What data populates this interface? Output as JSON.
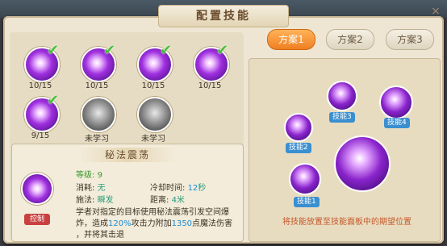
{
  "window": {
    "title": "配置技能",
    "close": "×"
  },
  "skills": [
    {
      "label": "10/15",
      "checked": true
    },
    {
      "label": "10/15",
      "checked": true
    },
    {
      "label": "10/15",
      "checked": true
    },
    {
      "label": "10/15",
      "checked": true
    },
    {
      "label": "9/15",
      "checked": true
    },
    {
      "label": "未学习",
      "checked": false
    },
    {
      "label": "未学习",
      "checked": false
    }
  ],
  "detail": {
    "name": "秘法震荡",
    "level_label": "等级: ",
    "level": "9",
    "cost_label": "消耗: ",
    "cost": "无",
    "cooldown_label": "冷却时间: ",
    "cooldown_value": "12",
    "cooldown_unit": "秒",
    "cast_label": "施法: ",
    "cast": "瞬发",
    "range_label": "距离: ",
    "range": "4米",
    "tag": "控制",
    "desc_1": "学者对指定的目标使用秘法震荡引发空间爆",
    "desc_2a": "炸，造成",
    "desc_pct": "120%",
    "desc_2b": "攻击力附加",
    "desc_val": "1350",
    "desc_2c": "点魔法伤害",
    "desc_3": "，并将其击退"
  },
  "tabs": [
    {
      "label": "方案1",
      "active": true
    },
    {
      "label": "方案2",
      "active": false
    },
    {
      "label": "方案3",
      "active": false
    }
  ],
  "slots": [
    "技能1",
    "技能2",
    "技能3",
    "技能4"
  ],
  "hint": "将技能放置至技能面板中的期望位置"
}
